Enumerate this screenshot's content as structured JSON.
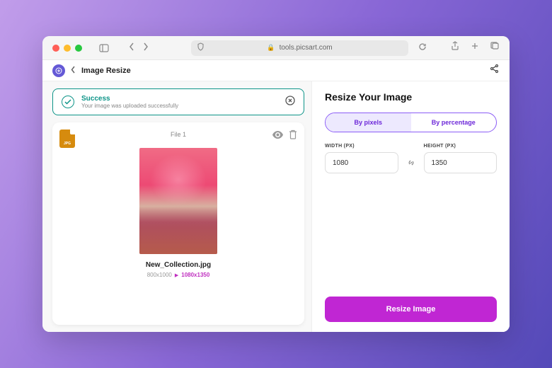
{
  "browser": {
    "url": "tools.picsart.com"
  },
  "header": {
    "title": "Image Resize"
  },
  "alert": {
    "title": "Success",
    "message": "Your image was uploaded successfully"
  },
  "file": {
    "badge": "JPG",
    "label": "File 1",
    "name": "New_Collection.jpg",
    "original_dims": "800x1000",
    "new_dims": "1080x1350"
  },
  "panel": {
    "title": "Resize Your Image",
    "tabs": {
      "pixels": "By pixels",
      "percentage": "By percentage"
    },
    "width_label": "WIDTH (PX)",
    "height_label": "HEIGHT (PX)",
    "width_value": "1080",
    "height_value": "1350",
    "cta": "Resize Image"
  }
}
